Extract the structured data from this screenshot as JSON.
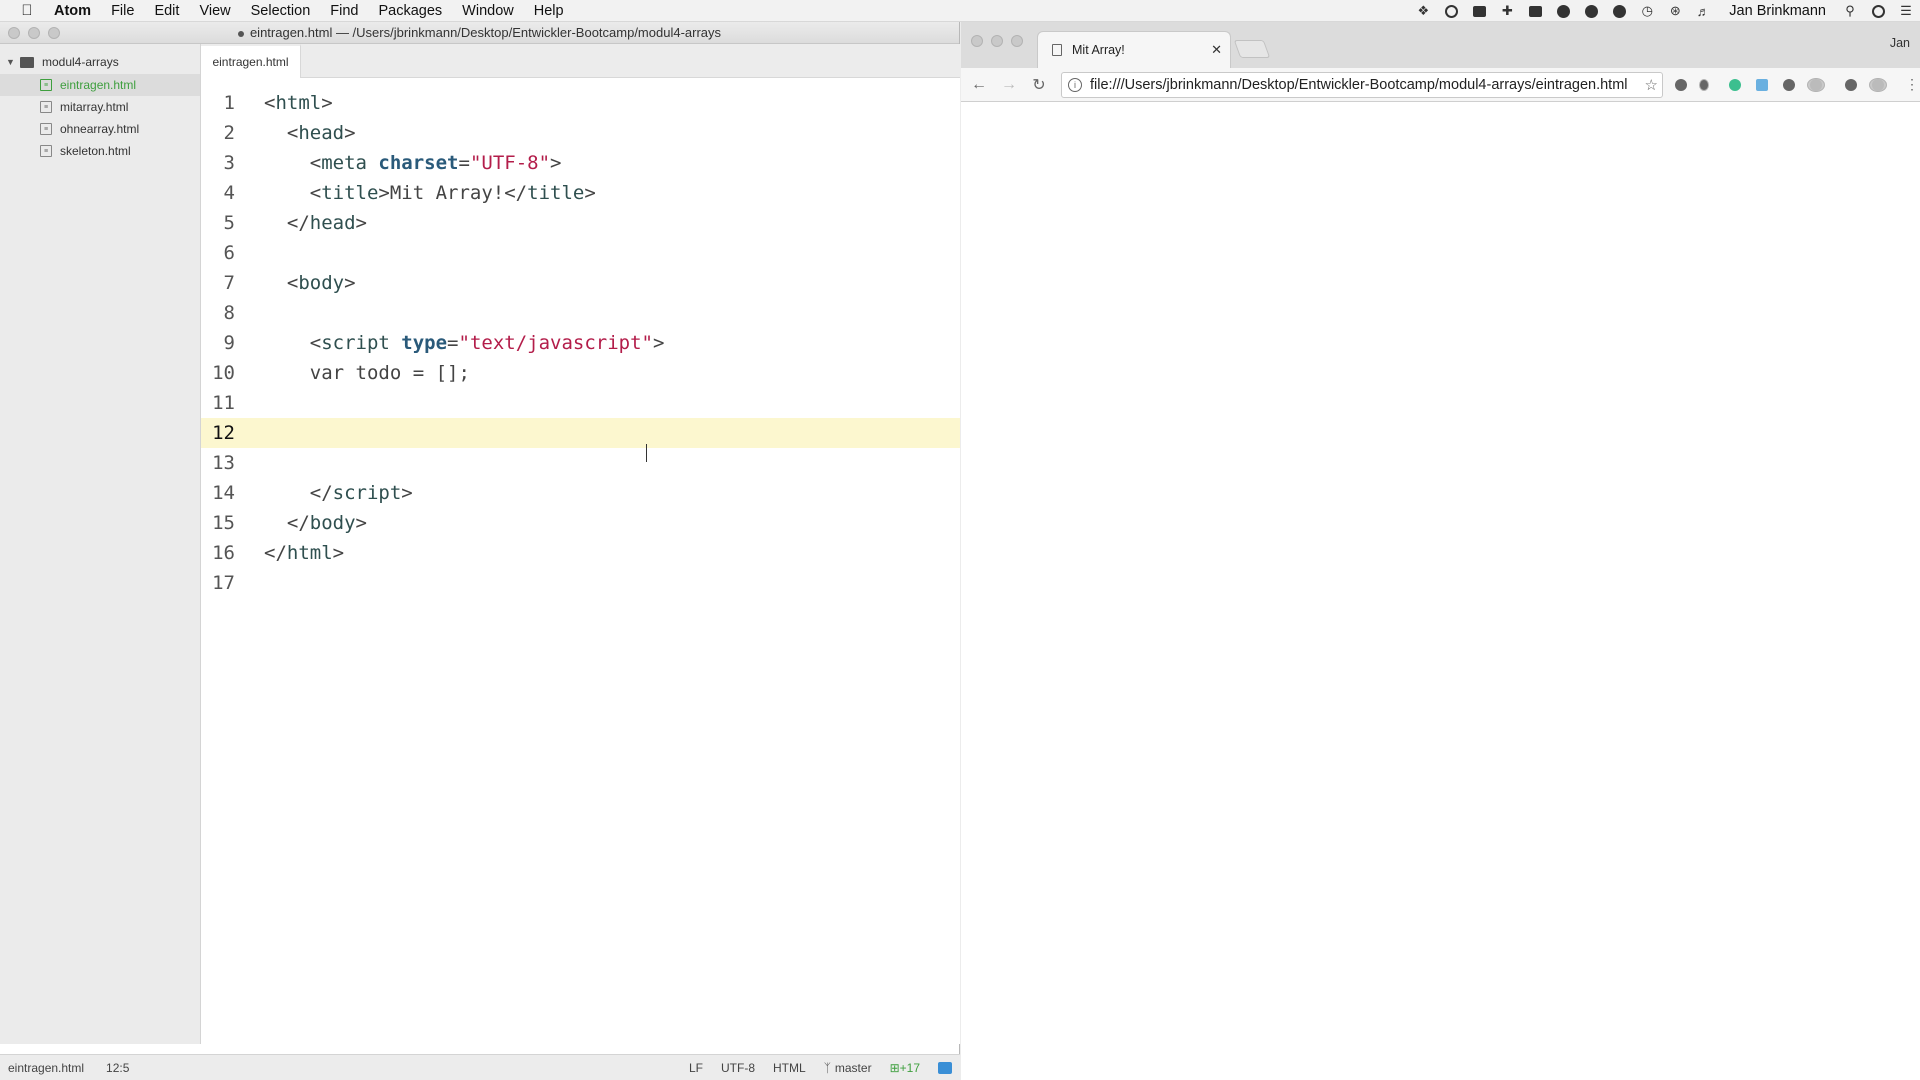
{
  "menubar": {
    "app": "Atom",
    "items": [
      "File",
      "Edit",
      "View",
      "Selection",
      "Find",
      "Packages",
      "Window",
      "Help"
    ],
    "user": "Jan Brinkmann"
  },
  "atom": {
    "title": "eintragen.html — /Users/jbrinkmann/Desktop/Entwickler-Bootcamp/modul4-arrays",
    "tree": {
      "root": "modul4-arrays",
      "files": [
        "eintragen.html",
        "mitarray.html",
        "ohnearray.html",
        "skeleton.html"
      ],
      "selected": "eintragen.html"
    },
    "tab": "eintragen.html",
    "code": {
      "current_line": 12,
      "lines": [
        [
          [
            "t-p",
            "<"
          ],
          [
            "t-tag",
            "html"
          ],
          [
            "t-p",
            ">"
          ]
        ],
        [
          [
            "t-p",
            "  <"
          ],
          [
            "t-tag",
            "head"
          ],
          [
            "t-p",
            ">"
          ]
        ],
        [
          [
            "t-p",
            "    <"
          ],
          [
            "t-tag",
            "meta "
          ],
          [
            "t-attr",
            "charset"
          ],
          [
            "t-p",
            "="
          ],
          [
            "t-str",
            "\"UTF-8\""
          ],
          [
            "t-p",
            ">"
          ]
        ],
        [
          [
            "t-p",
            "    <"
          ],
          [
            "t-tag",
            "title"
          ],
          [
            "t-p",
            ">Mit Array!</"
          ],
          [
            "t-tag",
            "title"
          ],
          [
            "t-p",
            ">"
          ]
        ],
        [
          [
            "t-p",
            "  </"
          ],
          [
            "t-tag",
            "head"
          ],
          [
            "t-p",
            ">"
          ]
        ],
        [],
        [
          [
            "t-p",
            "  <"
          ],
          [
            "t-tag",
            "body"
          ],
          [
            "t-p",
            ">"
          ]
        ],
        [],
        [
          [
            "t-p",
            "    <"
          ],
          [
            "t-tag",
            "script "
          ],
          [
            "t-attr",
            "type"
          ],
          [
            "t-p",
            "="
          ],
          [
            "t-str",
            "\"text/javascript\""
          ],
          [
            "t-p",
            ">"
          ]
        ],
        [
          [
            "t-p",
            "    var todo = [];"
          ]
        ],
        [],
        [],
        [],
        [
          [
            "t-p",
            "    </"
          ],
          [
            "t-tag",
            "script"
          ],
          [
            "t-p",
            ">"
          ]
        ],
        [
          [
            "t-p",
            "  </"
          ],
          [
            "t-tag",
            "body"
          ],
          [
            "t-p",
            ">"
          ]
        ],
        [
          [
            "t-p",
            "</"
          ],
          [
            "t-tag",
            "html"
          ],
          [
            "t-p",
            ">"
          ]
        ],
        []
      ]
    },
    "status": {
      "file": "eintragen.html",
      "cursor": "12:5",
      "line_ending": "LF",
      "encoding": "UTF-8",
      "grammar": "HTML",
      "branch": "master",
      "changes": "+17"
    }
  },
  "browser": {
    "tab_title": "Mit Array!",
    "user": "Jan",
    "url": "file:///Users/jbrinkmann/Desktop/Entwickler-Bootcamp/modul4-arrays/eintragen.html"
  },
  "icons": {
    "apple": "apple-logo-icon",
    "tray": [
      "dropbox-icon",
      "creative-cloud-icon",
      "camera-icon",
      "plus-icon",
      "drive-icon",
      "1password-icon",
      "app-icon",
      "notification-icon",
      "time-machine-icon",
      "bluetooth-icon",
      "volume-icon"
    ],
    "menubar_tail": [
      "spotlight-search-icon",
      "siri-icon",
      "notification-center-icon"
    ]
  }
}
